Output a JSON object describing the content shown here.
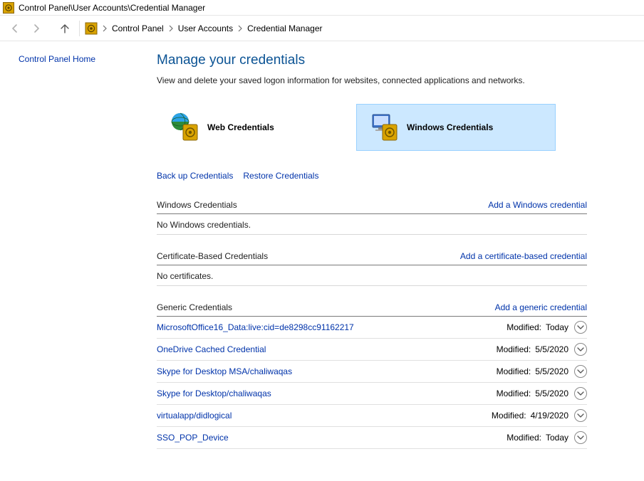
{
  "titlebar": {
    "text": "Control Panel\\User Accounts\\Credential Manager"
  },
  "breadcrumb": {
    "items": [
      "Control Panel",
      "User Accounts",
      "Credential Manager"
    ]
  },
  "sidebar": {
    "home_link": "Control Panel Home"
  },
  "main": {
    "title": "Manage your credentials",
    "description": "View and delete your saved logon information for websites, connected applications and networks.",
    "tiles": {
      "web": "Web Credentials",
      "windows": "Windows Credentials"
    },
    "actions": {
      "backup": "Back up Credentials",
      "restore": "Restore Credentials"
    },
    "sections": {
      "windows": {
        "title": "Windows Credentials",
        "add_link": "Add a Windows credential",
        "empty": "No Windows credentials."
      },
      "cert": {
        "title": "Certificate-Based Credentials",
        "add_link": "Add a certificate-based credential",
        "empty": "No certificates."
      },
      "generic": {
        "title": "Generic Credentials",
        "add_link": "Add a generic credential",
        "modified_label": "Modified:",
        "items": [
          {
            "name": "MicrosoftOffice16_Data:live:cid=de8298cc91162217",
            "modified": "Today"
          },
          {
            "name": "OneDrive Cached Credential",
            "modified": "5/5/2020"
          },
          {
            "name": "Skype for Desktop MSA/chaliwaqas",
            "modified": "5/5/2020"
          },
          {
            "name": "Skype for Desktop/chaliwaqas",
            "modified": "5/5/2020"
          },
          {
            "name": "virtualapp/didlogical",
            "modified": "4/19/2020"
          },
          {
            "name": "SSO_POP_Device",
            "modified": "Today"
          }
        ]
      }
    }
  }
}
